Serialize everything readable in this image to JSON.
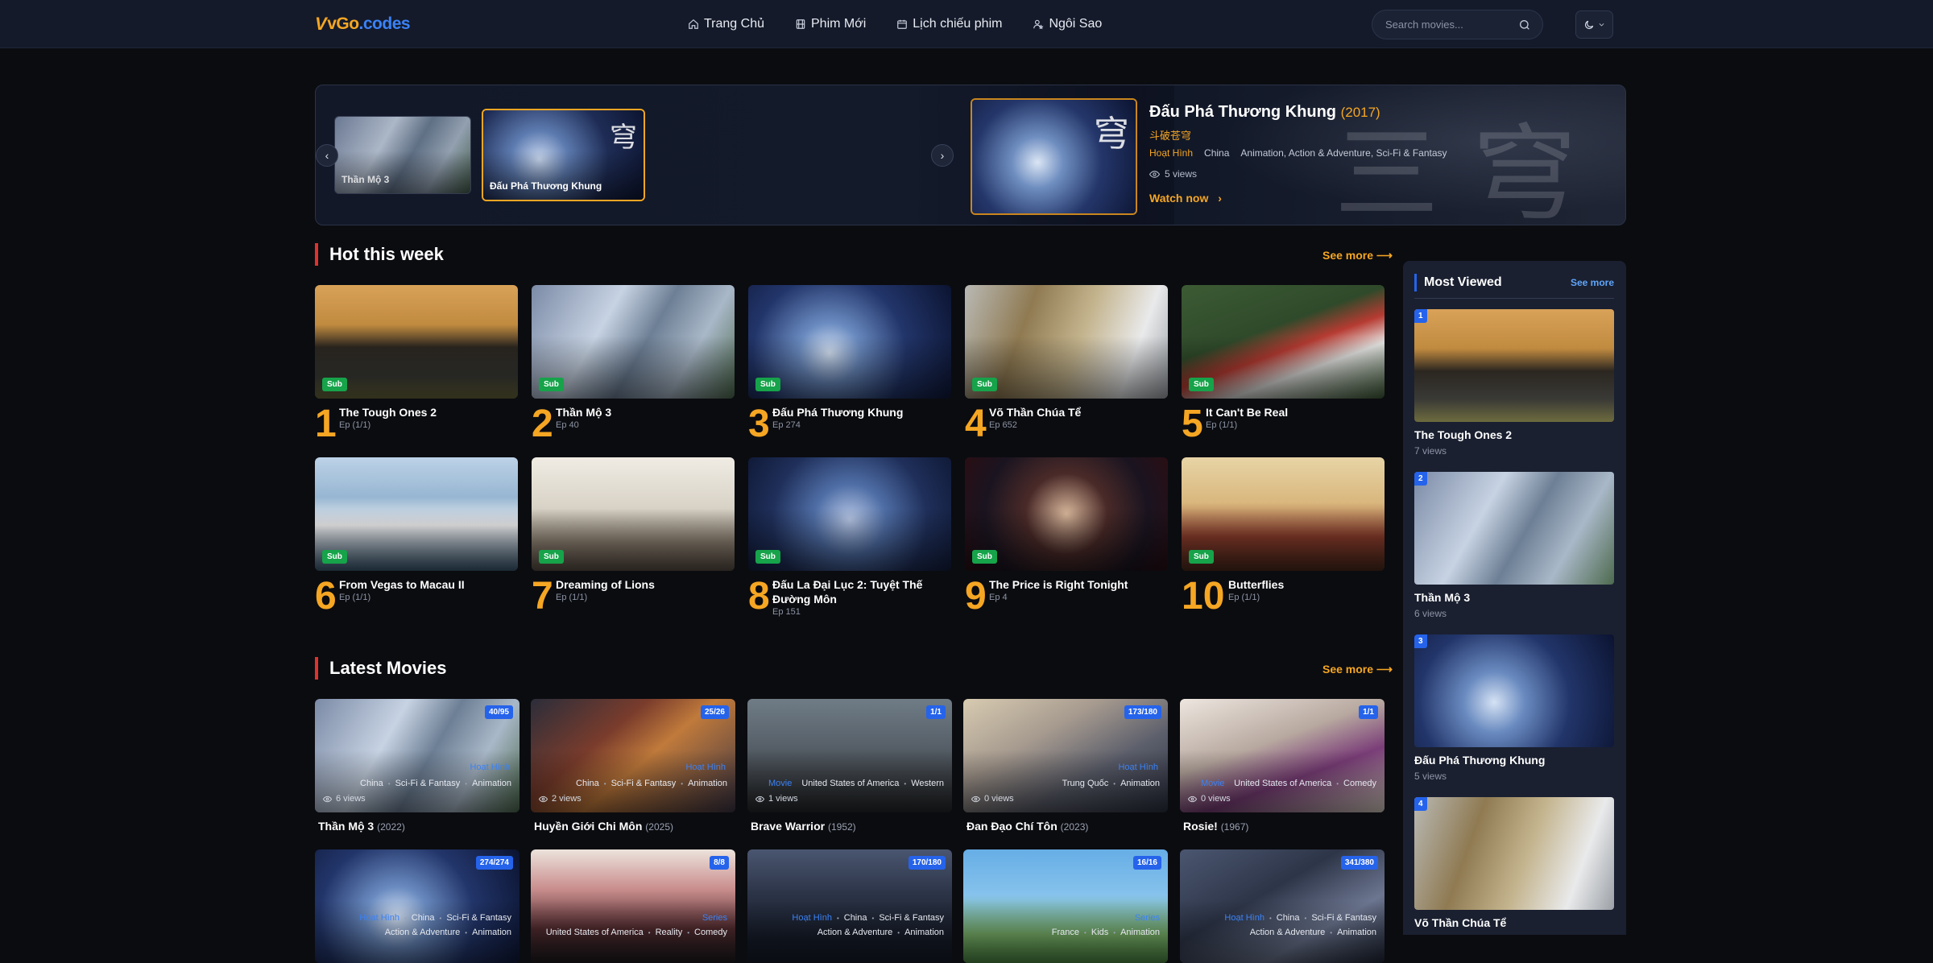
{
  "header": {
    "logo_mark": "V",
    "logo_a": "vGo",
    "logo_b": ".codes",
    "nav": [
      {
        "label": "Trang Chủ",
        "icon": "home-icon"
      },
      {
        "label": "Phim Mới",
        "icon": "film-icon"
      },
      {
        "label": "Lịch chiếu phim",
        "icon": "calendar-icon"
      },
      {
        "label": "Ngôi Sao",
        "icon": "user-star-icon"
      }
    ],
    "search_placeholder": "Search movies..."
  },
  "hero": {
    "thumbs": [
      {
        "caption": "Thần Mộ 3"
      },
      {
        "caption": "Đấu Phá Thương Khung"
      }
    ],
    "title": "Đấu Phá Thương Khung",
    "year": "(2017)",
    "original_title": "斗破苍穹",
    "category": "Hoạt Hình",
    "country": "China",
    "genres": "Animation, Action & Adventure, Sci-Fi & Fantasy",
    "views": "5 views",
    "watch_label": "Watch now",
    "prev_label": "‹",
    "next_label": "›"
  },
  "hot": {
    "title": "Hot this week",
    "see_more": "See more ⟶",
    "badge": "Sub",
    "items": [
      {
        "rank": "1",
        "name": "The Tough Ones 2",
        "ep": "Ep (1/1)"
      },
      {
        "rank": "2",
        "name": "Thần Mộ 3",
        "ep": "Ep 40"
      },
      {
        "rank": "3",
        "name": "Đấu Phá Thương Khung",
        "ep": "Ep 274"
      },
      {
        "rank": "4",
        "name": "Võ Thần Chúa Tể",
        "ep": "Ep 652"
      },
      {
        "rank": "5",
        "name": "It Can't Be Real",
        "ep": "Ep (1/1)"
      },
      {
        "rank": "6",
        "name": "From Vegas to Macau II",
        "ep": "Ep (1/1)"
      },
      {
        "rank": "7",
        "name": "Dreaming of Lions",
        "ep": "Ep (1/1)"
      },
      {
        "rank": "8",
        "name": "Đấu La Đại Lục 2: Tuyệt Thế Đường Môn",
        "ep": "Ep 151"
      },
      {
        "rank": "9",
        "name": "The Price is Right Tonight",
        "ep": "Ep 4"
      },
      {
        "rank": "10",
        "name": "Butterflies",
        "ep": "Ep (1/1)"
      }
    ]
  },
  "latest": {
    "title": "Latest Movies",
    "see_more": "See more ⟶",
    "items": [
      {
        "name": "Thần Mộ 3",
        "year": "(2022)",
        "badge": "40/95",
        "category": "Hoạt Hình",
        "tags": [
          "China",
          "Sci-Fi & Fantasy",
          "Animation"
        ],
        "views": "6 views"
      },
      {
        "name": "Huyền Giới Chi Môn",
        "year": "(2025)",
        "badge": "25/26",
        "category": "Hoạt Hình",
        "tags": [
          "China",
          "Sci-Fi & Fantasy",
          "Animation"
        ],
        "views": "2 views"
      },
      {
        "name": "Brave Warrior",
        "year": "(1952)",
        "badge": "1/1",
        "category": "Movie",
        "tags": [
          "United States of America",
          "Western"
        ],
        "views": "1 views"
      },
      {
        "name": "Đan Đạo Chí Tôn",
        "year": "(2023)",
        "badge": "173/180",
        "category": "Hoạt Hình",
        "tags": [
          "Trung Quốc",
          "Animation"
        ],
        "views": "0 views"
      },
      {
        "name": "Rosie!",
        "year": "(1967)",
        "badge": "1/1",
        "category": "Movie",
        "tags": [
          "United States of America",
          "Comedy"
        ],
        "views": "0 views"
      }
    ],
    "row2": [
      {
        "badge": "274/274",
        "category": "Hoạt Hình",
        "tags": [
          "China",
          "Sci-Fi & Fantasy"
        ],
        "tags2": [
          "Action & Adventure",
          "Animation"
        ]
      },
      {
        "badge": "8/8",
        "category": "Series",
        "tags": [],
        "tags2": [
          "United States of America",
          "Reality",
          "Comedy"
        ]
      },
      {
        "badge": "170/180",
        "category": "Hoạt Hình",
        "tags": [
          "China",
          "Sci-Fi & Fantasy"
        ],
        "tags2": [
          "Action & Adventure",
          "Animation"
        ]
      },
      {
        "badge": "16/16",
        "category": "Series",
        "tags": [],
        "tags2": [
          "France",
          "Kids",
          "Animation"
        ]
      },
      {
        "badge": "341/380",
        "category": "Hoạt Hình",
        "tags": [
          "China",
          "Sci-Fi & Fantasy"
        ],
        "tags2": [
          "Action & Adventure",
          "Animation"
        ]
      }
    ]
  },
  "sidebar": {
    "title": "Most Viewed",
    "see_more": "See more",
    "items": [
      {
        "num": "1",
        "name": "The Tough Ones 2",
        "views": "7 views"
      },
      {
        "num": "2",
        "name": "Thần Mộ 3",
        "views": "6 views"
      },
      {
        "num": "3",
        "name": "Đấu Phá Thương Khung",
        "views": "5 views"
      },
      {
        "num": "4",
        "name": "Võ Thần Chúa Tể",
        "views": ""
      }
    ]
  },
  "colors": {
    "accent": "#f5a623",
    "link_blue": "#2563eb",
    "section_red": "#e0322d",
    "sub_green": "#16a34a"
  }
}
